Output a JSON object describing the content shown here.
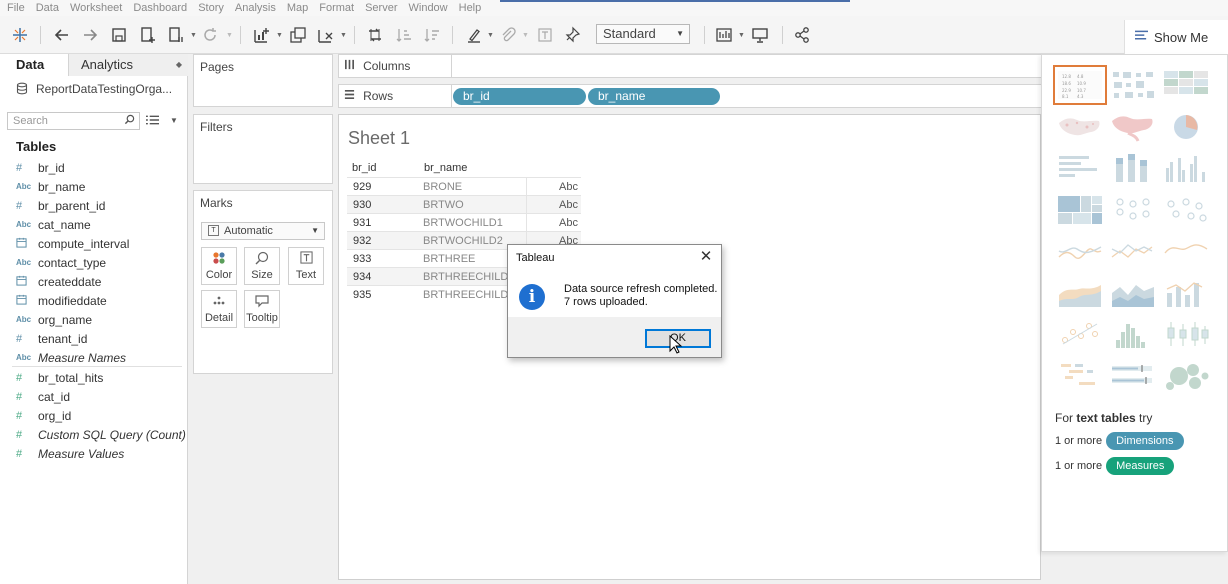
{
  "menu": [
    "File",
    "Data",
    "Worksheet",
    "Dashboard",
    "Story",
    "Analysis",
    "Map",
    "Format",
    "Server",
    "Window",
    "Help"
  ],
  "toolbar": {
    "fit_select": "Standard",
    "show_me_label": "Show Me"
  },
  "data_pane": {
    "tab_data": "Data",
    "tab_analytics": "Analytics",
    "source_name": "ReportDataTestingOrga...",
    "search_placeholder": "Search",
    "tables_heading": "Tables",
    "fields": [
      {
        "type": "#",
        "name": "br_id"
      },
      {
        "type": "Abc",
        "name": "br_name"
      },
      {
        "type": "#",
        "name": "br_parent_id"
      },
      {
        "type": "Abc",
        "name": "cat_name"
      },
      {
        "type": "date",
        "name": "compute_interval"
      },
      {
        "type": "Abc",
        "name": "contact_type"
      },
      {
        "type": "date",
        "name": "createddate"
      },
      {
        "type": "date",
        "name": "modifieddate"
      },
      {
        "type": "Abc",
        "name": "org_name"
      },
      {
        "type": "#",
        "name": "tenant_id"
      },
      {
        "type": "Abc",
        "name": "Measure Names"
      }
    ],
    "measures": [
      {
        "type": "#",
        "name": "br_total_hits"
      },
      {
        "type": "#",
        "name": "cat_id"
      },
      {
        "type": "#",
        "name": "org_id"
      },
      {
        "type": "#",
        "name": "Custom SQL Query (Count)"
      },
      {
        "type": "#",
        "name": "Measure Values"
      }
    ]
  },
  "cards": {
    "pages": "Pages",
    "filters": "Filters",
    "marks": "Marks",
    "mark_type": "Automatic",
    "mark_buttons": [
      "Color",
      "Size",
      "Text",
      "Detail",
      "Tooltip"
    ]
  },
  "shelves": {
    "columns_label": "Columns",
    "rows_label": "Rows",
    "rows_pills": [
      "br_id",
      "br_name"
    ]
  },
  "sheet": {
    "title": "Sheet 1",
    "headers": [
      "br_id",
      "br_name"
    ],
    "rows": [
      {
        "id": "929",
        "name": "BRONE",
        "val": "Abc"
      },
      {
        "id": "930",
        "name": "BRTWO",
        "val": "Abc"
      },
      {
        "id": "931",
        "name": "BRTWOCHILD1",
        "val": "Abc"
      },
      {
        "id": "932",
        "name": "BRTWOCHILD2",
        "val": "Abc"
      },
      {
        "id": "933",
        "name": "BRTHREE",
        "val": "Abc"
      },
      {
        "id": "934",
        "name": "BRTHREECHILD1",
        "val": "Abc"
      },
      {
        "id": "935",
        "name": "BRTHREECHILD2",
        "val": "Abc"
      }
    ]
  },
  "show_me": {
    "for_prefix": "For",
    "for_bold": "text tables",
    "for_suffix": "try",
    "req1_prefix": "1 or more",
    "req1_pill": "Dimensions",
    "req2_prefix": "1 or more",
    "req2_pill": "Measures",
    "colors": {
      "dimension": "#4996b2",
      "measure": "#17a27b",
      "selected": "#e07c3a"
    }
  },
  "dialog": {
    "title": "Tableau",
    "line1": "Data source refresh completed.",
    "line2": "7 rows uploaded.",
    "ok_label": "OK"
  }
}
